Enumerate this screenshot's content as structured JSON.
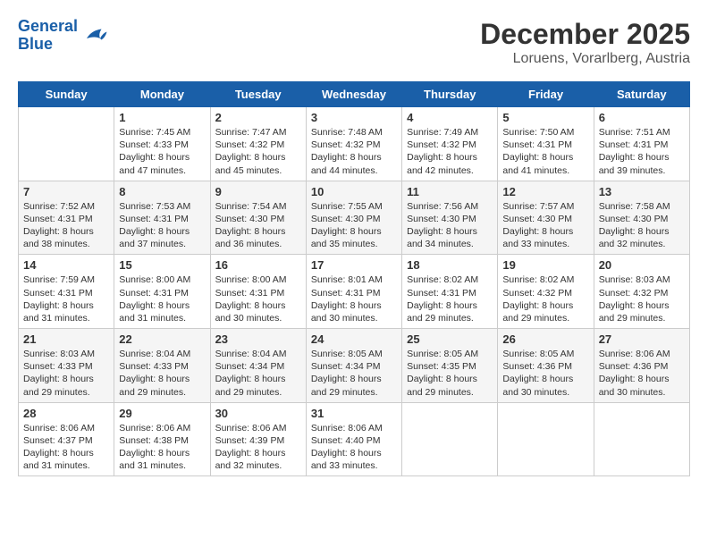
{
  "header": {
    "logo_line1": "General",
    "logo_line2": "Blue",
    "month_year": "December 2025",
    "location": "Loruens, Vorarlberg, Austria"
  },
  "weekdays": [
    "Sunday",
    "Monday",
    "Tuesday",
    "Wednesday",
    "Thursday",
    "Friday",
    "Saturday"
  ],
  "weeks": [
    [
      {
        "day": "",
        "info": ""
      },
      {
        "day": "1",
        "info": "Sunrise: 7:45 AM\nSunset: 4:33 PM\nDaylight: 8 hours\nand 47 minutes."
      },
      {
        "day": "2",
        "info": "Sunrise: 7:47 AM\nSunset: 4:32 PM\nDaylight: 8 hours\nand 45 minutes."
      },
      {
        "day": "3",
        "info": "Sunrise: 7:48 AM\nSunset: 4:32 PM\nDaylight: 8 hours\nand 44 minutes."
      },
      {
        "day": "4",
        "info": "Sunrise: 7:49 AM\nSunset: 4:32 PM\nDaylight: 8 hours\nand 42 minutes."
      },
      {
        "day": "5",
        "info": "Sunrise: 7:50 AM\nSunset: 4:31 PM\nDaylight: 8 hours\nand 41 minutes."
      },
      {
        "day": "6",
        "info": "Sunrise: 7:51 AM\nSunset: 4:31 PM\nDaylight: 8 hours\nand 39 minutes."
      }
    ],
    [
      {
        "day": "7",
        "info": "Sunrise: 7:52 AM\nSunset: 4:31 PM\nDaylight: 8 hours\nand 38 minutes."
      },
      {
        "day": "8",
        "info": "Sunrise: 7:53 AM\nSunset: 4:31 PM\nDaylight: 8 hours\nand 37 minutes."
      },
      {
        "day": "9",
        "info": "Sunrise: 7:54 AM\nSunset: 4:30 PM\nDaylight: 8 hours\nand 36 minutes."
      },
      {
        "day": "10",
        "info": "Sunrise: 7:55 AM\nSunset: 4:30 PM\nDaylight: 8 hours\nand 35 minutes."
      },
      {
        "day": "11",
        "info": "Sunrise: 7:56 AM\nSunset: 4:30 PM\nDaylight: 8 hours\nand 34 minutes."
      },
      {
        "day": "12",
        "info": "Sunrise: 7:57 AM\nSunset: 4:30 PM\nDaylight: 8 hours\nand 33 minutes."
      },
      {
        "day": "13",
        "info": "Sunrise: 7:58 AM\nSunset: 4:30 PM\nDaylight: 8 hours\nand 32 minutes."
      }
    ],
    [
      {
        "day": "14",
        "info": "Sunrise: 7:59 AM\nSunset: 4:31 PM\nDaylight: 8 hours\nand 31 minutes."
      },
      {
        "day": "15",
        "info": "Sunrise: 8:00 AM\nSunset: 4:31 PM\nDaylight: 8 hours\nand 31 minutes."
      },
      {
        "day": "16",
        "info": "Sunrise: 8:00 AM\nSunset: 4:31 PM\nDaylight: 8 hours\nand 30 minutes."
      },
      {
        "day": "17",
        "info": "Sunrise: 8:01 AM\nSunset: 4:31 PM\nDaylight: 8 hours\nand 30 minutes."
      },
      {
        "day": "18",
        "info": "Sunrise: 8:02 AM\nSunset: 4:31 PM\nDaylight: 8 hours\nand 29 minutes."
      },
      {
        "day": "19",
        "info": "Sunrise: 8:02 AM\nSunset: 4:32 PM\nDaylight: 8 hours\nand 29 minutes."
      },
      {
        "day": "20",
        "info": "Sunrise: 8:03 AM\nSunset: 4:32 PM\nDaylight: 8 hours\nand 29 minutes."
      }
    ],
    [
      {
        "day": "21",
        "info": "Sunrise: 8:03 AM\nSunset: 4:33 PM\nDaylight: 8 hours\nand 29 minutes."
      },
      {
        "day": "22",
        "info": "Sunrise: 8:04 AM\nSunset: 4:33 PM\nDaylight: 8 hours\nand 29 minutes."
      },
      {
        "day": "23",
        "info": "Sunrise: 8:04 AM\nSunset: 4:34 PM\nDaylight: 8 hours\nand 29 minutes."
      },
      {
        "day": "24",
        "info": "Sunrise: 8:05 AM\nSunset: 4:34 PM\nDaylight: 8 hours\nand 29 minutes."
      },
      {
        "day": "25",
        "info": "Sunrise: 8:05 AM\nSunset: 4:35 PM\nDaylight: 8 hours\nand 29 minutes."
      },
      {
        "day": "26",
        "info": "Sunrise: 8:05 AM\nSunset: 4:36 PM\nDaylight: 8 hours\nand 30 minutes."
      },
      {
        "day": "27",
        "info": "Sunrise: 8:06 AM\nSunset: 4:36 PM\nDaylight: 8 hours\nand 30 minutes."
      }
    ],
    [
      {
        "day": "28",
        "info": "Sunrise: 8:06 AM\nSunset: 4:37 PM\nDaylight: 8 hours\nand 31 minutes."
      },
      {
        "day": "29",
        "info": "Sunrise: 8:06 AM\nSunset: 4:38 PM\nDaylight: 8 hours\nand 31 minutes."
      },
      {
        "day": "30",
        "info": "Sunrise: 8:06 AM\nSunset: 4:39 PM\nDaylight: 8 hours\nand 32 minutes."
      },
      {
        "day": "31",
        "info": "Sunrise: 8:06 AM\nSunset: 4:40 PM\nDaylight: 8 hours\nand 33 minutes."
      },
      {
        "day": "",
        "info": ""
      },
      {
        "day": "",
        "info": ""
      },
      {
        "day": "",
        "info": ""
      }
    ]
  ]
}
